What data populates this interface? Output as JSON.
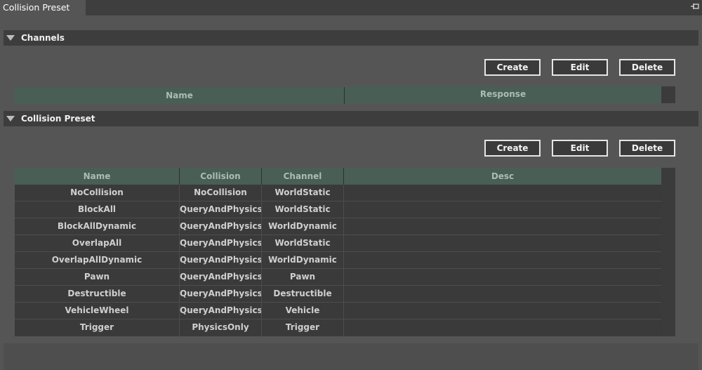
{
  "window": {
    "tab_title": "Collision Preset",
    "pin_icon": "pin-icon"
  },
  "channels": {
    "title": "Channels",
    "buttons": {
      "create": "Create",
      "edit": "Edit",
      "delete": "Delete"
    },
    "columns": [
      "Name",
      "Response"
    ]
  },
  "presets": {
    "title": "Collision Preset",
    "buttons": {
      "create": "Create",
      "edit": "Edit",
      "delete": "Delete"
    },
    "columns": [
      "Name",
      "Collision",
      "Channel",
      "Desc"
    ],
    "rows": [
      [
        "NoCollision",
        "NoCollision",
        "WorldStatic",
        ""
      ],
      [
        "BlockAll",
        "QueryAndPhysics",
        "WorldStatic",
        ""
      ],
      [
        "BlockAllDynamic",
        "QueryAndPhysics",
        "WorldDynamic",
        ""
      ],
      [
        "OverlapAll",
        "QueryAndPhysics",
        "WorldStatic",
        ""
      ],
      [
        "OverlapAllDynamic",
        "QueryAndPhysics",
        "WorldDynamic",
        ""
      ],
      [
        "Pawn",
        "QueryAndPhysics",
        "Pawn",
        ""
      ],
      [
        "Destructible",
        "QueryAndPhysics",
        "Destructible",
        ""
      ],
      [
        "VehicleWheel",
        "QueryAndPhysics",
        "Vehicle",
        ""
      ],
      [
        "Trigger",
        "PhysicsOnly",
        "Trigger",
        ""
      ]
    ]
  },
  "colors": {
    "header_bg": "#495e54",
    "header_text": "#a9bdb3",
    "row_bg": "#3a3a3a",
    "panel_bg": "#555555"
  }
}
